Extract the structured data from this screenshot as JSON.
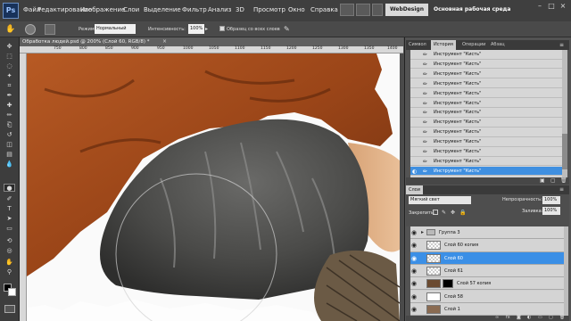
{
  "menubar": {
    "logo": "Ps",
    "items": [
      "Файл",
      "Редактирование",
      "Изображение",
      "Слои",
      "Выделение",
      "Фильтр",
      "Анализ",
      "3D",
      "Просмотр",
      "Окно",
      "Справка"
    ],
    "workspace_button": "WebDesign",
    "workspace_label": "Основная рабочая среда",
    "window_buttons": [
      "–",
      "□",
      "×"
    ]
  },
  "options": {
    "mode_label": "Режим:",
    "mode_value": "Нормальный",
    "intensity_label": "Интенсивность:",
    "intensity_value": "100%",
    "sample_all_label": "Образец со всех слоев"
  },
  "document": {
    "tab_title": "Обработка людей.psd @ 200% (Слой 60, RGB/8) *",
    "ruler_ticks": [
      "750",
      "800",
      "850",
      "900",
      "950",
      "1000",
      "1050",
      "1100",
      "1150",
      "1200",
      "1250",
      "1300",
      "1350",
      "1400"
    ]
  },
  "history": {
    "tabs": [
      "Символ",
      "История",
      "Операции",
      "Абзац"
    ],
    "active_tab": "История",
    "rows": [
      "Инструмент \"Кисть\"",
      "Инструмент \"Кисть\"",
      "Инструмент \"Кисть\"",
      "Инструмент \"Кисть\"",
      "Инструмент \"Кисть\"",
      "Инструмент \"Кисть\"",
      "Инструмент \"Кисть\"",
      "Инструмент \"Кисть\"",
      "Инструмент \"Кисть\"",
      "Инструмент \"Кисть\"",
      "Инструмент \"Кисть\"",
      "Инструмент \"Кисть\"",
      "Инструмент \"Кисть\""
    ],
    "selected_index": 12
  },
  "layers": {
    "tab": "Слои",
    "blend_mode": "Мягкий свет",
    "opacity_label": "Непрозрачность:",
    "opacity_value": "100%",
    "lock_label": "Закрепить:",
    "fill_label": "Заливка:",
    "fill_value": "100%",
    "rows": [
      {
        "name": "Группа 3",
        "selected": false
      },
      {
        "name": "Слой 60 копия",
        "selected": false
      },
      {
        "name": "Слой 60",
        "selected": true
      },
      {
        "name": "Слой 61",
        "selected": false
      },
      {
        "name": "Слой 57 копия",
        "selected": false
      },
      {
        "name": "Слой 58",
        "selected": false
      },
      {
        "name": "Слой 1",
        "selected": false
      }
    ]
  },
  "colors": {
    "accent": "#3b8fe6",
    "shirt": "#a8501e",
    "shorts": "#4a4a48"
  }
}
